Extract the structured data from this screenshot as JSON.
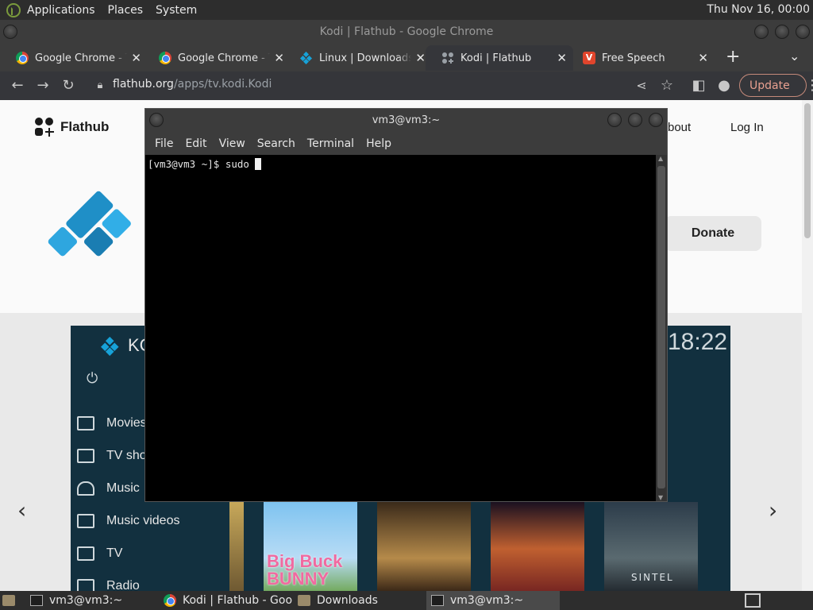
{
  "top_panel": {
    "menus": [
      "Applications",
      "Places",
      "System"
    ],
    "clock": "Thu Nov 16, 00:00"
  },
  "chrome": {
    "window_title": "Kodi | Flathub - Google Chrome",
    "tabs": [
      {
        "label": "Google Chrome - Th",
        "icon": "chrome-icon"
      },
      {
        "label": "Google Chrome - Th",
        "icon": "chrome-icon"
      },
      {
        "label": "Linux | Downloads |",
        "icon": "kodi-icon"
      },
      {
        "label": "Kodi | Flathub",
        "icon": "flathub-icon",
        "active": true
      },
      {
        "label": "Free Speech",
        "icon": "video-icon"
      }
    ],
    "url_host": "flathub.org",
    "url_path": "/apps/tv.kodi.Kodi",
    "update_label": "Update"
  },
  "flathub_page": {
    "logo_text": "Flathub",
    "nav": {
      "about": "bout",
      "login": "Log In"
    },
    "donate_label": "Donate",
    "kodi_screenshot": {
      "brand": "KC",
      "time": "18:22",
      "menu": [
        "Movies",
        "TV sho",
        "Music",
        "Music videos",
        "TV",
        "Radio"
      ],
      "poster_titles": [
        "Big Buck BUNNY",
        "SINTEL"
      ]
    }
  },
  "terminal": {
    "title": "vm3@vm3:~",
    "menus": [
      "File",
      "Edit",
      "View",
      "Search",
      "Terminal",
      "Help"
    ],
    "line": "[vm3@vm3 ~]$ sudo "
  },
  "taskbar": {
    "items": [
      {
        "label": "vm3@vm3:~",
        "icon": "terminal-icon"
      },
      {
        "label": "Kodi | Flathub - Goo...",
        "icon": "chrome-icon"
      },
      {
        "label": "Downloads",
        "icon": "folder-icon"
      },
      {
        "label": "vm3@vm3:~",
        "icon": "terminal-icon",
        "active": true
      }
    ]
  }
}
